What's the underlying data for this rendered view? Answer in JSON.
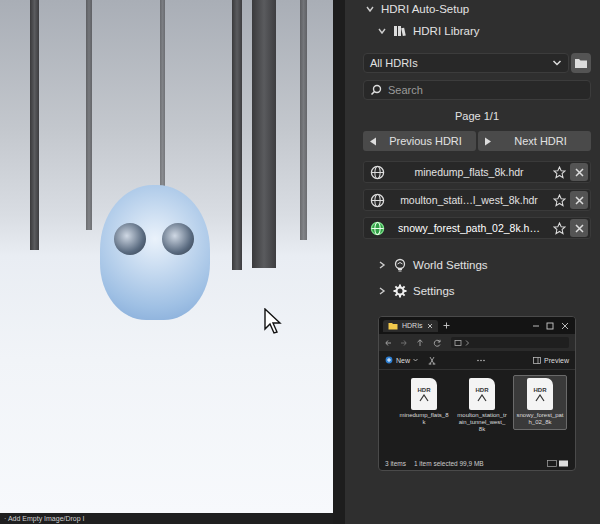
{
  "viewport": {
    "status_text": "· Add Empty Image/Drop I"
  },
  "panel": {
    "title": "HDRI Auto-Setup",
    "expanded": true
  },
  "library": {
    "title": "HDRI Library",
    "expanded": true,
    "filter": "All HDRIs",
    "search_placeholder": "Search",
    "page": "Page 1/1",
    "prev_label": "Previous HDRI",
    "next_label": "Next HDRI"
  },
  "hdris": [
    {
      "name": "minedump_flats_8k.hdr",
      "selected": false,
      "favorite": false
    },
    {
      "name": "moulton_stati…l_west_8k.hdr",
      "selected": false,
      "favorite": false
    },
    {
      "name": "snowy_forest_path_02_8k.h…",
      "selected": true,
      "favorite": false
    }
  ],
  "sections": [
    {
      "label": "World Settings",
      "expanded": false,
      "kind": "world"
    },
    {
      "label": "Settings",
      "expanded": false,
      "kind": "gear"
    }
  ],
  "explorer": {
    "title": "HDRIs",
    "new_label": "New",
    "preview_label": "Preview",
    "files": [
      {
        "name": "minedump_flats_8k",
        "ext": "HDR",
        "selected": false
      },
      {
        "name": "moulton_station_train_tunnel_west_8k",
        "ext": "HDR",
        "selected": false
      },
      {
        "name": "snowy_forest_path_02_8k",
        "ext": "HDR",
        "selected": true
      }
    ],
    "item_count": "3 items",
    "selection_info": "1 item selected  99,9 MB"
  }
}
